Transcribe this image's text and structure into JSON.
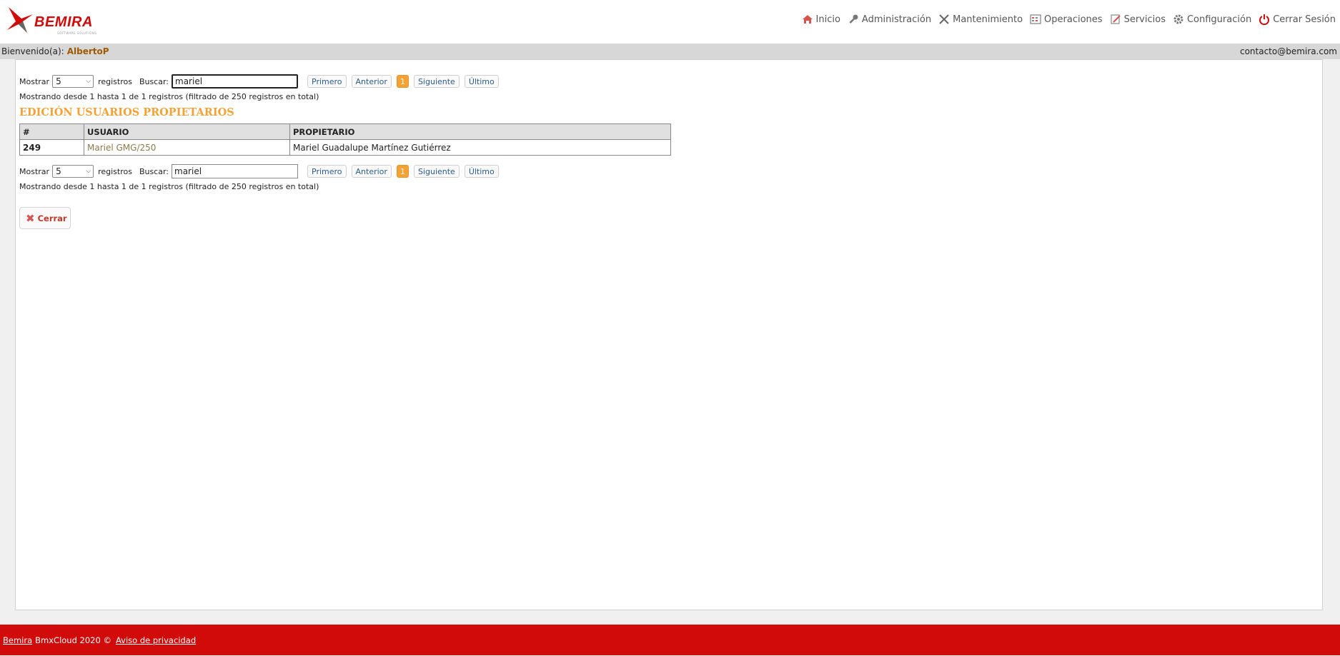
{
  "brand": {
    "name": "BEMIRA",
    "tagline": "SOFTWARE SOLUTIONS",
    "accent": "#d10a0a"
  },
  "nav": [
    {
      "label": "Inicio",
      "icon": "home-icon"
    },
    {
      "label": "Administración",
      "icon": "key-icon"
    },
    {
      "label": "Mantenimiento",
      "icon": "tools-icon"
    },
    {
      "label": "Operaciones",
      "icon": "grid-icon"
    },
    {
      "label": "Servicios",
      "icon": "edit-icon"
    },
    {
      "label": "Configuración",
      "icon": "gear-icon"
    },
    {
      "label": "Cerrar Sesión",
      "icon": "power-icon"
    }
  ],
  "welcome": {
    "prefix": "Bienvenido(a):",
    "user": "AlbertoP",
    "contact": "contacto@bemira.com"
  },
  "controls": {
    "show_label": "Mostrar",
    "show_value": "5",
    "records_label": "registros",
    "search_label": "Buscar:",
    "search_value": "mariel",
    "pager": {
      "first": "Primero",
      "prev": "Anterior",
      "page": "1",
      "next": "Siguiente",
      "last": "Último"
    },
    "info": "Mostrando desde 1 hasta 1 de 1 registros (filtrado de 250 registros en total)"
  },
  "section_title": "EDICIÓN USUARIOS PROPIETARIOS",
  "table": {
    "headers": [
      "#",
      "USUARIO",
      "PROPIETARIO"
    ],
    "rows": [
      {
        "id": "249",
        "usuario": "Mariel GMG/250",
        "propietario": "Mariel Guadalupe Martínez Gutiérrez"
      }
    ]
  },
  "close_button": "Cerrar",
  "footer": {
    "brand_link": "Bemira",
    "text": "BmxCloud 2020 ©",
    "privacy_link": "Aviso de privacidad"
  }
}
